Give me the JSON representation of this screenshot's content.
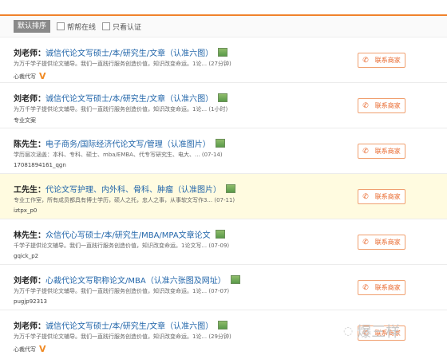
{
  "filter": {
    "sort_label": "默认排序",
    "opt1": "帮帮在线",
    "opt2": "只看认证"
  },
  "contact_label": "联系商家",
  "rows": [
    {
      "name": "刘老师：",
      "title": "诚信代论文写硕士/本/研究生/文章（认准六图）",
      "desc": "为万千学子提供论文辅导。我们一直践行服务创造价值，知识改变命运。1论... (27分钟)",
      "extra": "心裁代写",
      "badge": "V"
    },
    {
      "name": "刘老师：",
      "title": "诚信代论文写硕士/本/研究生/文章（认准六图）",
      "desc": "为万千学子提供论文辅导。我们一直践行服务创造价值，知识改变命运。1论... (1小时)",
      "extra": "专业文案",
      "badge": ""
    },
    {
      "name": "陈先生：",
      "title": "电子商务/国际经济代论文写/管理（认准图片）",
      "desc": "学历层次涵盖：本科、专科、硕士、mba/EMBA、代专写研究生、电大、... (07-14)",
      "extra": "17081894161_qgn",
      "badge": ""
    },
    {
      "name": "工先生：",
      "title": "代论文写护理、内外科、骨科、肿瘤（认准图片）",
      "desc": "专业工作室，所有成员都具有博士学历，硕人之托，忠人之事，从事软文写作3... (07-11)",
      "extra": "iztpx_p0",
      "badge": ""
    },
    {
      "name": "林先生：",
      "title": "众信代心写硕士/本/研究生/MBA/MPA文章论文",
      "desc": "千学子提供论文辅导。我们一直践行服务创造价值，知识改变命运。1论文写... (07-09)",
      "extra": "gqick_p2",
      "badge": ""
    },
    {
      "name": "刘老师：",
      "title": "心裁代论文写职称论文/MBA（认准六张图及网址）",
      "desc": "为万千学子提供论文辅导。我们一直践行服务创造价值，知识改变命运。1论... (07-07)",
      "extra": "pugjp92313",
      "badge": ""
    },
    {
      "name": "刘老师：",
      "title": "诚信代论文写硕士/本/研究生/文章（认准六图）",
      "desc": "为万千学子提供论文辅导。我们一直践行服务创造价值，知识改变命运。1论... (29分钟)",
      "extra": "心裁代写",
      "badge": "V"
    }
  ],
  "watermark": "爆三样"
}
